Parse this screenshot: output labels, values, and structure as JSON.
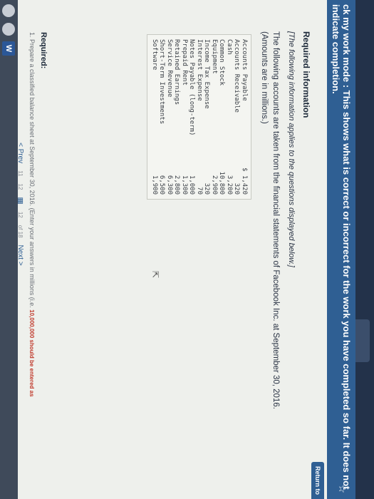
{
  "banner": {
    "text": "ck my work mode : This shows what is correct or incorrect for the work you have completed so far. It does not indicate completion."
  },
  "return_button": "Return to",
  "required_information_title": "Required information",
  "intro_text": "[The following information applies to the questions displayed below.]",
  "paragraph": "The following accounts are taken from the financial statements of Facebook Inc. at September 30, 2016. (Amounts are in millions.)",
  "accounts": [
    {
      "name": "Accounts Payable",
      "amount": "$ 1,420"
    },
    {
      "name": "Accounts Receivable",
      "amount": "320"
    },
    {
      "name": "Cash",
      "amount": "3,200"
    },
    {
      "name": "Common Stock",
      "amount": "10,800"
    },
    {
      "name": "Equipment",
      "amount": "2,900"
    },
    {
      "name": "Income Tax Expense",
      "amount": "320"
    },
    {
      "name": "Interest Expense",
      "amount": "70"
    },
    {
      "name": "Notes Payable (long-term)",
      "amount": "1,000"
    },
    {
      "name": "Prepaid Rent",
      "amount": "1,300"
    },
    {
      "name": "Retained Earnings",
      "amount": "2,800"
    },
    {
      "name": "Service Revenue",
      "amount": "6,300"
    },
    {
      "name": "Short-Term Investments",
      "amount": "6,500"
    },
    {
      "name": "Software",
      "amount": "1,900"
    }
  ],
  "required": {
    "label": "Required:",
    "item_number": "1.",
    "item_text": "Prepare a classified balance sheet at September 30, 2016. (Enter your answers in millions (i.e.",
    "item_hint": "10,000,000 should be entered as"
  },
  "pager": {
    "prev": "< Prev",
    "page_a": "11",
    "page_b": "12",
    "page_sep": "12",
    "of_text": "of 18",
    "next": "Next >"
  },
  "taskbar": {
    "word_label": "W"
  }
}
